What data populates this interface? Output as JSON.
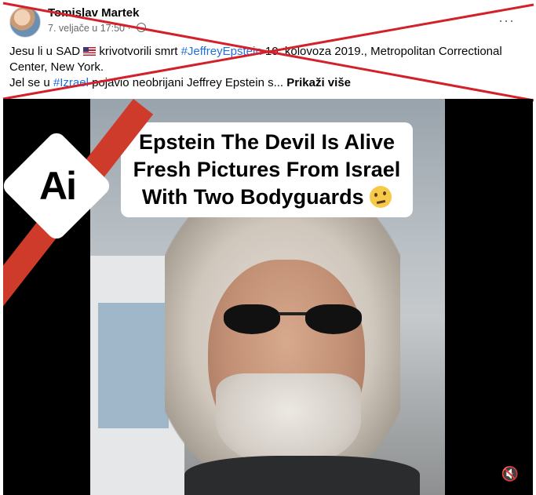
{
  "post": {
    "author": "Tomislav Martek",
    "timestamp": "7. veljače u 17:50",
    "text_line1_a": "Jesu li u SAD ",
    "text_line1_b": " krivotvorili smrt ",
    "hashtag_epstein": "#JeffreyEpstein",
    "text_line1_c": " 10. kolovoza 2019., Metropolitan Correctional Center, New York.",
    "text_line2_a": "Jel se u ",
    "hashtag_israel": "#Izrael",
    "text_line2_b": " pojavio neobrijani Jeffrey Epstein s... ",
    "see_more": "Prikaži više",
    "more_menu": "···"
  },
  "video": {
    "caption_line1": "Epstein The Devil Is Alive",
    "caption_line2": "Fresh Pictures From Israel",
    "caption_line3": "With Two Bodyguards",
    "badge": "Ai",
    "volume_icon": "🔇"
  },
  "colors": {
    "cross": "#d3202a",
    "hashtag": "#216fdb",
    "slash": "#cf3b2a"
  }
}
